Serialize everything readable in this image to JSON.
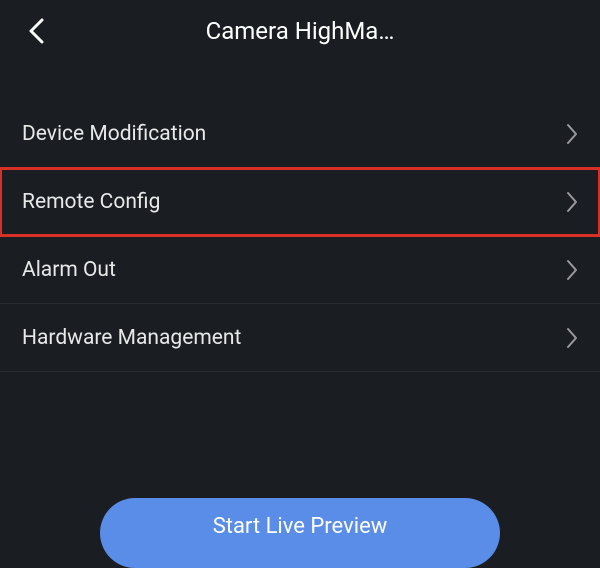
{
  "header": {
    "title": "Camera HighMa…"
  },
  "menu": {
    "items": [
      {
        "label": "Device Modification",
        "highlighted": false
      },
      {
        "label": "Remote Config",
        "highlighted": true
      },
      {
        "label": "Alarm Out",
        "highlighted": false
      },
      {
        "label": "Hardware Management",
        "highlighted": false
      }
    ]
  },
  "footer": {
    "button_label": "Start Live Preview"
  },
  "colors": {
    "background": "#1a1d21",
    "text_primary": "#ffffff",
    "text_secondary": "#e8e8e8",
    "divider": "#2a2d31",
    "chevron": "#9a9a9a",
    "highlight": "#d93025",
    "button": "#5a8de8"
  }
}
